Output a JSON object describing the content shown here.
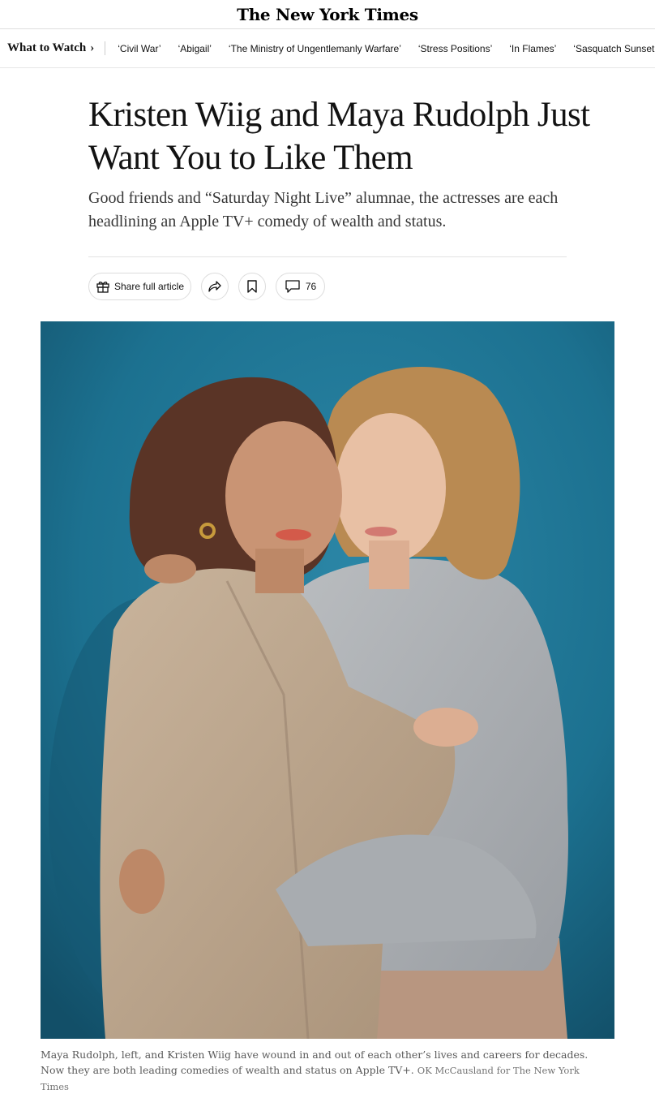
{
  "masthead": {
    "logo_text": "The New York Times"
  },
  "subnav": {
    "section_label": "What to Watch",
    "chevron": "›",
    "links": [
      "‘Civil War’",
      "‘Abigail’",
      "‘The Ministry of Ungentlemanly Warfare’",
      "‘Stress Positions’",
      "‘In Flames’",
      "‘Sasquatch Sunset’"
    ]
  },
  "article": {
    "headline": "Kristen Wiig and Maya Rudolph Just Want You to Like Them",
    "summary": "Good friends and “Saturday Night Live” alumnae, the actresses are each headlining an Apple TV+ comedy of wealth and status."
  },
  "toolbar": {
    "share_full_label": "Share full article",
    "comment_count": "76",
    "icons": [
      "gift-icon",
      "share-arrow-icon",
      "bookmark-icon",
      "comment-icon"
    ]
  },
  "photo": {
    "caption": "Maya Rudolph, left, and Kristen Wiig have wound in and out of each other’s lives and careers for decades. Now they are both leading comedies of wealth and status on Apple TV+.",
    "credit": "OK McCausland for The New York Times"
  },
  "colors": {
    "text": "#121212",
    "photo_background": "#1c7190",
    "caption_text": "#5a5a5a"
  }
}
